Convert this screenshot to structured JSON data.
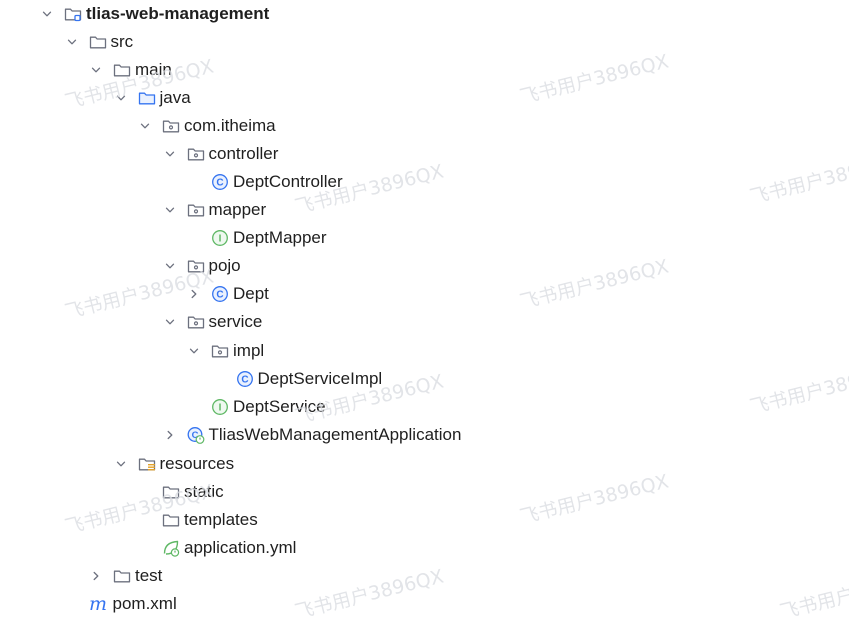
{
  "tree": [
    {
      "label": "tlias-web-management",
      "icon": "module-folder-icon",
      "expanded": true,
      "level": 0
    },
    {
      "label": "src",
      "icon": "folder-icon",
      "expanded": true,
      "level": 1
    },
    {
      "label": "main",
      "icon": "folder-icon",
      "expanded": true,
      "level": 2
    },
    {
      "label": "java",
      "icon": "source-folder-icon",
      "expanded": true,
      "level": 3
    },
    {
      "label": "com.itheima",
      "icon": "package-icon",
      "expanded": true,
      "level": 4
    },
    {
      "label": "controller",
      "icon": "package-icon",
      "expanded": true,
      "level": 5
    },
    {
      "label": "DeptController",
      "icon": "class-icon",
      "level": 6
    },
    {
      "label": "mapper",
      "icon": "package-icon",
      "expanded": true,
      "level": 5
    },
    {
      "label": "DeptMapper",
      "icon": "interface-icon",
      "level": 6
    },
    {
      "label": "pojo",
      "icon": "package-icon",
      "expanded": true,
      "level": 5
    },
    {
      "label": "Dept",
      "icon": "class-icon",
      "expanded": false,
      "level": 6
    },
    {
      "label": "service",
      "icon": "package-icon",
      "expanded": true,
      "level": 5
    },
    {
      "label": "impl",
      "icon": "package-icon",
      "expanded": true,
      "level": 6
    },
    {
      "label": "DeptServiceImpl",
      "icon": "class-icon",
      "level": 7
    },
    {
      "label": "DeptService",
      "icon": "interface-icon",
      "level": 6
    },
    {
      "label": "TliasWebManagementApplication",
      "icon": "spring-boot-class-icon",
      "expanded": false,
      "level": 5
    },
    {
      "label": "resources",
      "icon": "resources-folder-icon",
      "expanded": true,
      "level": 3
    },
    {
      "label": "static",
      "icon": "folder-icon",
      "level": 4
    },
    {
      "label": "templates",
      "icon": "folder-icon",
      "level": 4
    },
    {
      "label": "application.yml",
      "icon": "spring-config-icon",
      "level": 4
    },
    {
      "label": "test",
      "icon": "folder-icon",
      "expanded": false,
      "level": 2
    },
    {
      "label": "pom.xml",
      "icon": "maven-icon",
      "level": 1
    }
  ],
  "watermark": "飞书用户3896QX",
  "colors": {
    "chevron": "#6c707e",
    "folder_stroke": "#6c707e",
    "source_folder": "#3574f0",
    "class_icon": "#3574f0",
    "interface_icon": "#5fb865",
    "spring": "#5fb865",
    "resources_accent": "#e5a32a",
    "maven": "#3574f0",
    "watermark": "#d9dce1"
  }
}
